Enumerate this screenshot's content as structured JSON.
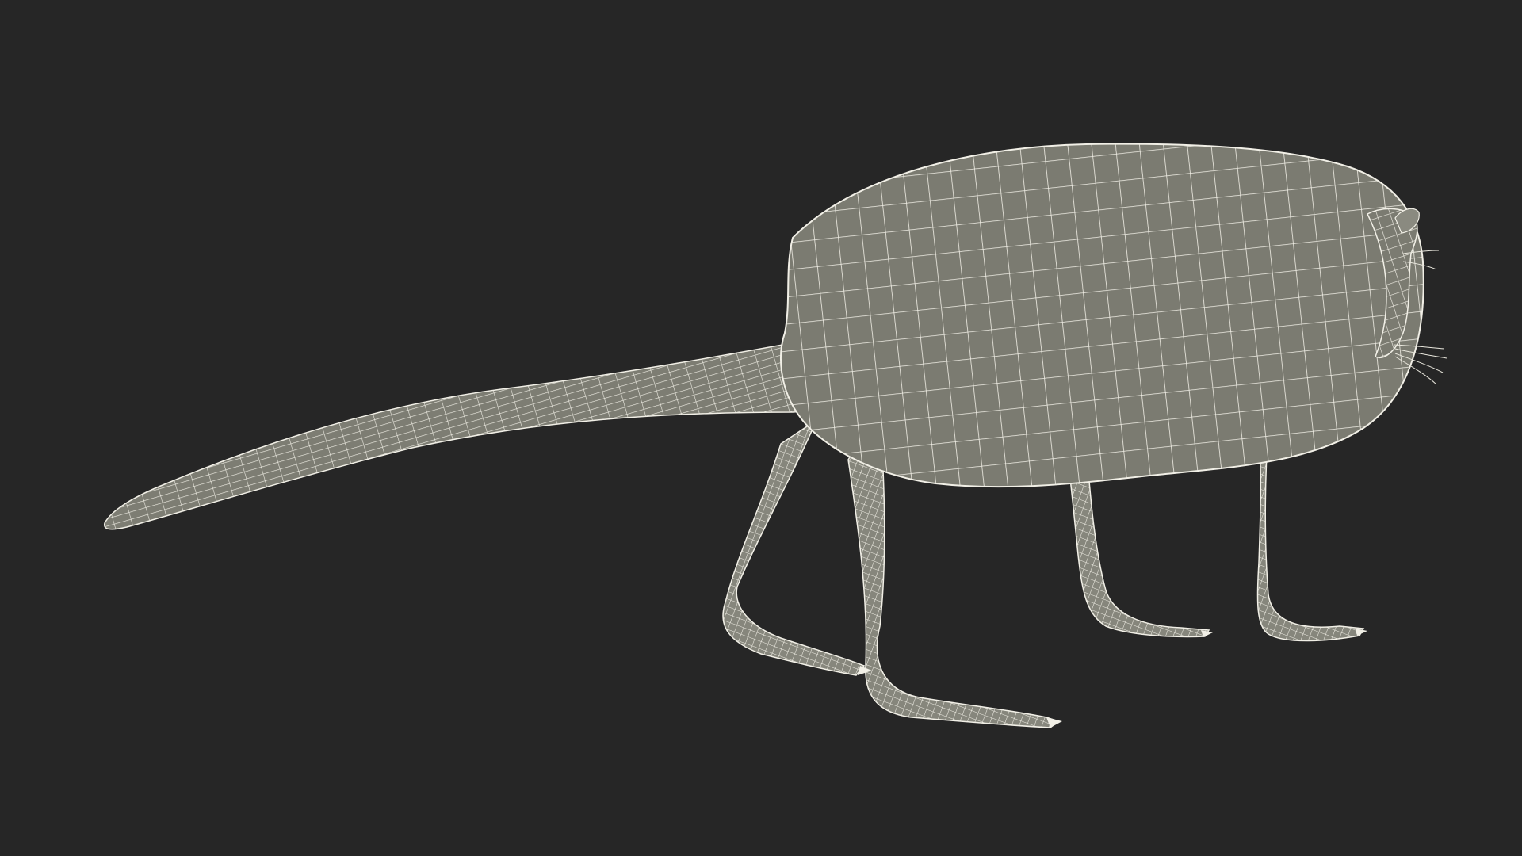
{
  "scene": {
    "subject_icon": "wireframe-animal-model",
    "background_color": "#262626",
    "mesh_fill_color": "#7b7b71",
    "mesh_line_color": "#f1efe6"
  }
}
